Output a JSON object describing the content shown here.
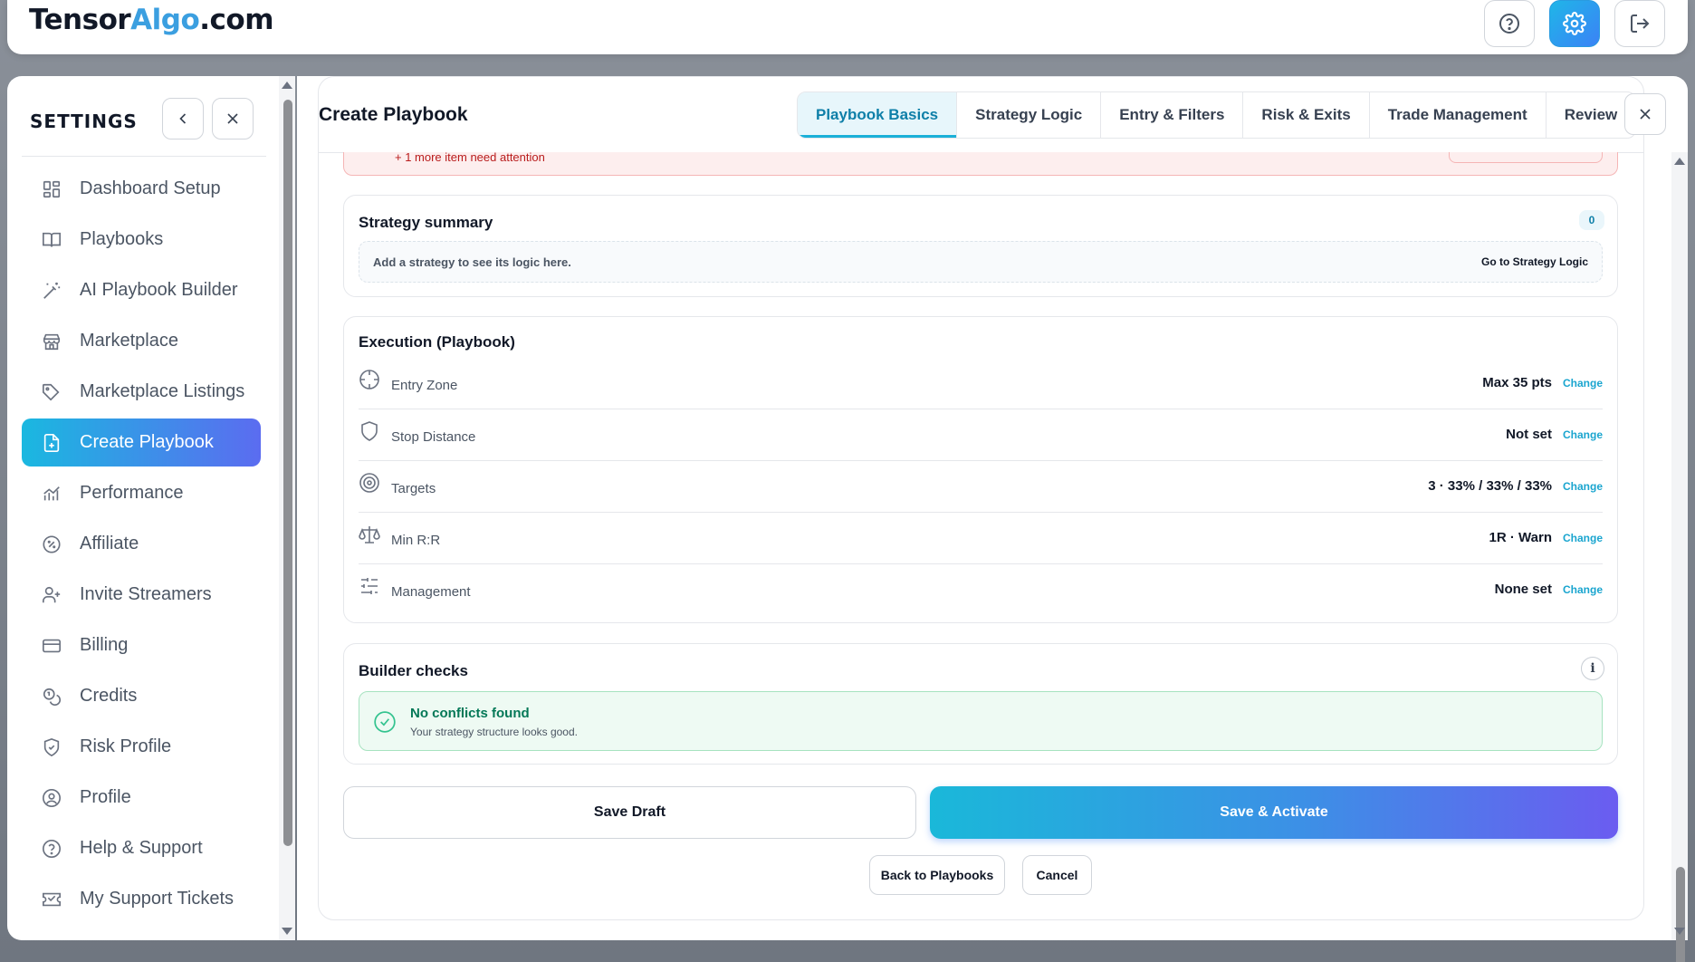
{
  "header": {
    "logo_part1": "Tensor",
    "logo_part2": "Algo",
    "logo_part3": ".com",
    "buttons": [
      {
        "name": "help",
        "icon": "question-circle-icon"
      },
      {
        "name": "settings",
        "icon": "gear-icon",
        "active": true
      },
      {
        "name": "logout",
        "icon": "logout-icon"
      }
    ]
  },
  "sidebar": {
    "title": "SETTINGS",
    "items": [
      {
        "label": "Dashboard Setup",
        "icon": "dashboard-grid-icon"
      },
      {
        "label": "Playbooks",
        "icon": "book-icon"
      },
      {
        "label": "AI Playbook Builder",
        "icon": "magic-wand-icon"
      },
      {
        "label": "Marketplace",
        "icon": "store-icon"
      },
      {
        "label": "Marketplace Listings",
        "icon": "tags-icon"
      },
      {
        "label": "Create Playbook",
        "icon": "file-plus-icon",
        "active": true
      },
      {
        "label": "Performance",
        "icon": "chart-icon"
      },
      {
        "label": "Affiliate",
        "icon": "percent-badge-icon"
      },
      {
        "label": "Invite Streamers",
        "icon": "user-plus-icon"
      },
      {
        "label": "Billing",
        "icon": "credit-card-icon"
      },
      {
        "label": "Credits",
        "icon": "coins-icon"
      },
      {
        "label": "Risk Profile",
        "icon": "shield-check-icon"
      },
      {
        "label": "Profile",
        "icon": "user-circle-icon"
      },
      {
        "label": "Help & Support",
        "icon": "help-circle-icon"
      },
      {
        "label": "My Support Tickets",
        "icon": "ticket-icon"
      }
    ]
  },
  "modal": {
    "title": "Create Playbook",
    "tabs": [
      {
        "label": "Playbook Basics",
        "active": true
      },
      {
        "label": "Strategy Logic"
      },
      {
        "label": "Entry & Filters"
      },
      {
        "label": "Risk & Exits"
      },
      {
        "label": "Trade Management"
      },
      {
        "label": "Review"
      }
    ],
    "alert_more": "+ 1 more item need attention",
    "strategy_summary": {
      "title": "Strategy summary",
      "count": "0",
      "hint": "Add a strategy to see its logic here.",
      "link": "Go to Strategy Logic"
    },
    "execution": {
      "title": "Execution (Playbook)",
      "rows": [
        {
          "label": "Entry Zone",
          "value": "Max 35 pts",
          "action": "Change",
          "icon": "crosshair-icon"
        },
        {
          "label": "Stop Distance",
          "value": "Not set",
          "action": "Change",
          "icon": "shield-icon"
        },
        {
          "label": "Targets",
          "value": "3 · 33% / 33% / 33%",
          "action": "Change",
          "icon": "target-icon"
        },
        {
          "label": "Min R:R",
          "value": "1R · Warn",
          "action": "Change",
          "icon": "scale-icon"
        },
        {
          "label": "Management",
          "value": "None set",
          "action": "Change",
          "icon": "sliders-icon"
        }
      ]
    },
    "builder_checks": {
      "title": "Builder checks",
      "info": "i",
      "status_title": "No conflicts found",
      "status_sub": "Your strategy structure looks good."
    },
    "actions": {
      "save_draft": "Save Draft",
      "save_activate": "Save & Activate",
      "back": "Back to Playbooks",
      "cancel": "Cancel"
    }
  },
  "colors": {
    "accent": "#1ab8e0",
    "accent_end": "#6b5cf0",
    "success": "#047857",
    "danger": "#b91c1c"
  }
}
